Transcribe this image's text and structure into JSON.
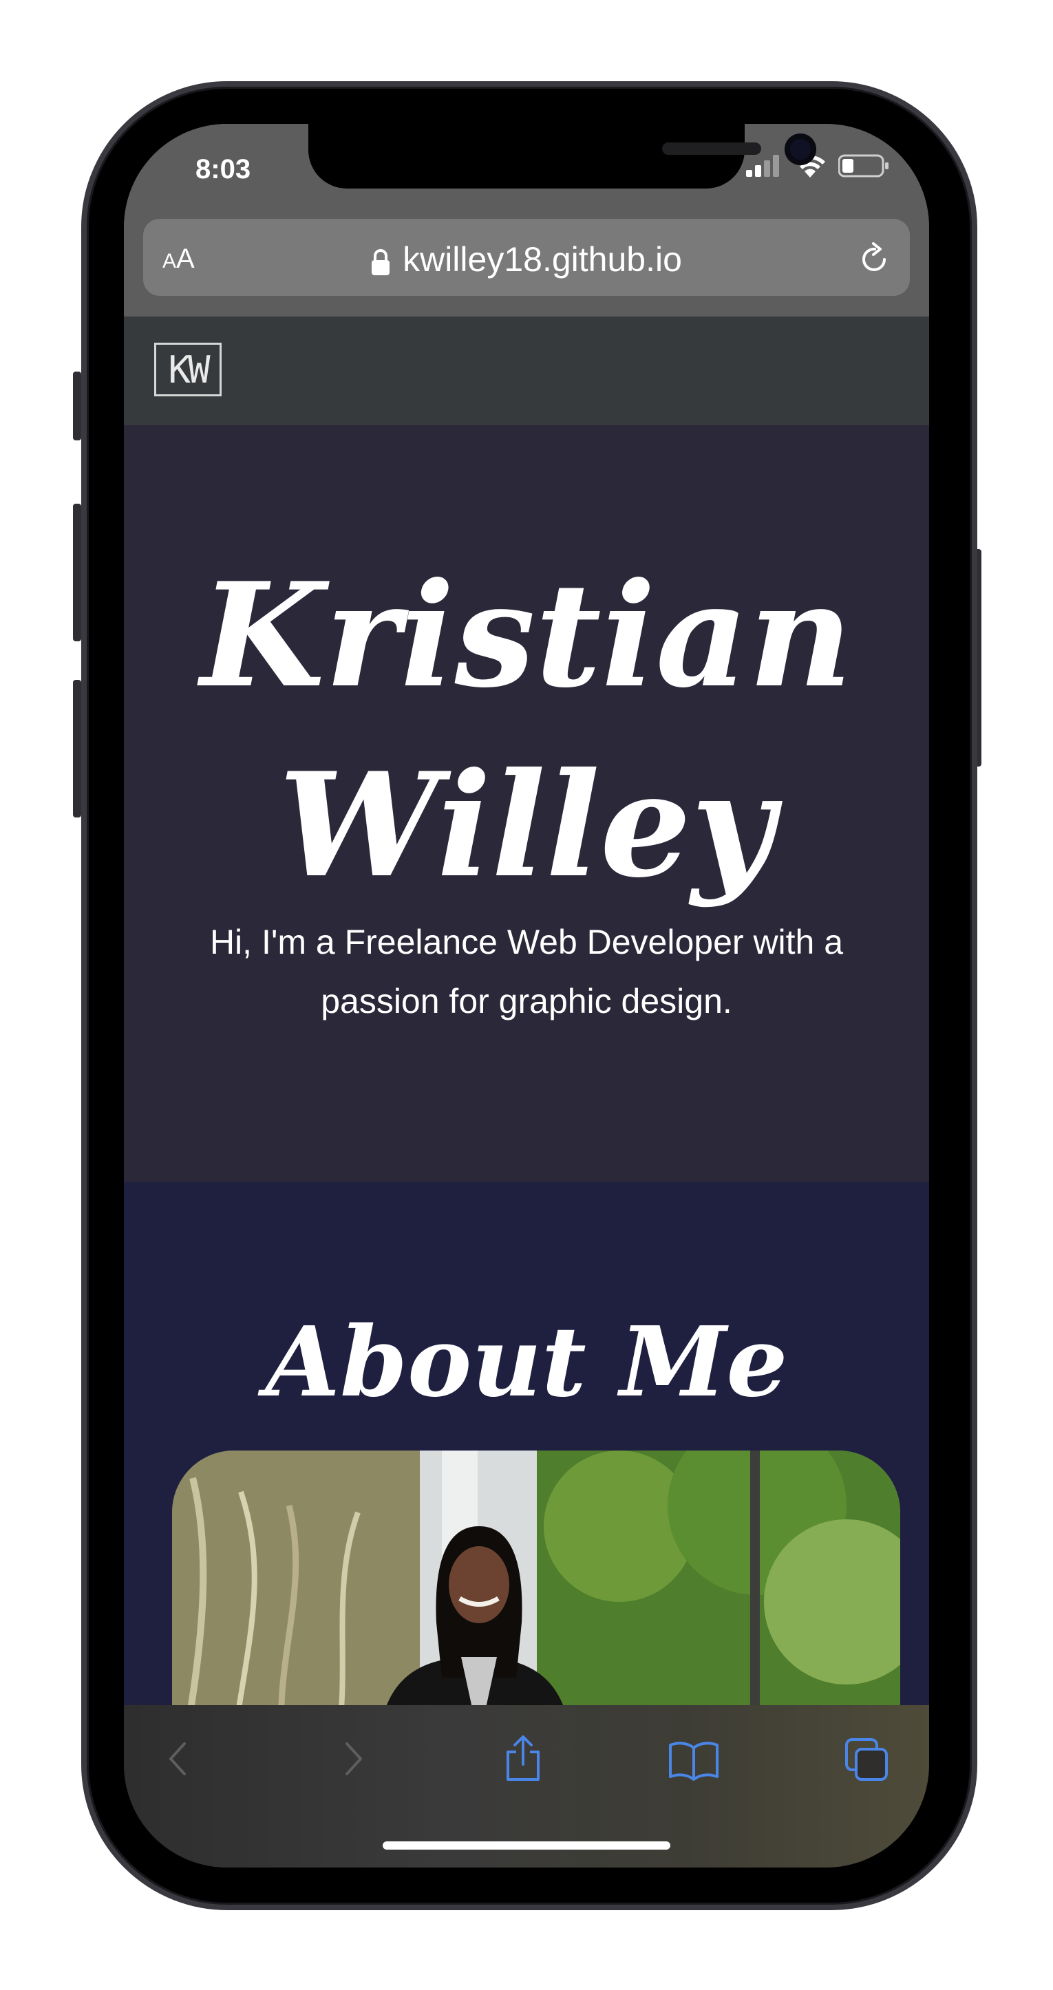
{
  "status_bar": {
    "time": "8:03"
  },
  "browser": {
    "text_size_label_small": "A",
    "text_size_label_large": "A",
    "url": "kwilley18.github.io"
  },
  "site": {
    "logo_text": "KW",
    "hero": {
      "name_line1": "Kristian",
      "name_line2": "Willey",
      "tagline": "Hi, I'm a Freelance Web Developer with a passion for graphic design."
    },
    "about": {
      "title": "About Me"
    }
  },
  "colors": {
    "hero_bg": "#2a2839",
    "about_bg": "#1f2040",
    "navbar_bg": "#363a3c",
    "toolbar_accent": "#4a86e8"
  },
  "icons": {
    "status": [
      "signal-icon",
      "wifi-icon",
      "battery-icon"
    ],
    "browser": [
      "lock-icon",
      "reload-icon"
    ],
    "toolbar": [
      "back-icon",
      "forward-icon",
      "share-icon",
      "bookmarks-icon",
      "tabs-icon"
    ]
  }
}
